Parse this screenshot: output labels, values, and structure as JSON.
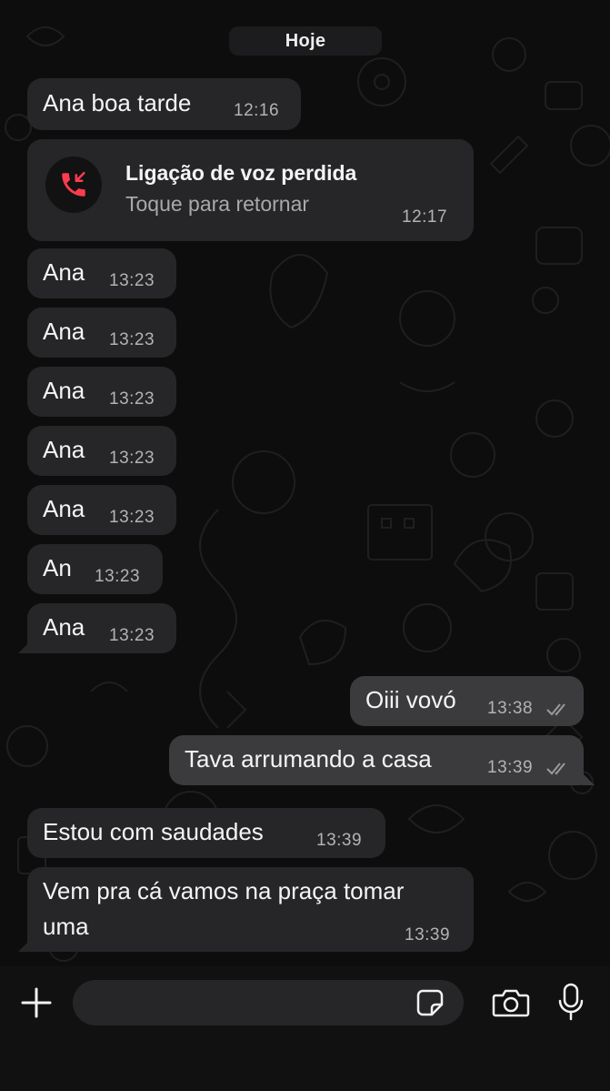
{
  "date_label": "Hoje",
  "messages": [
    {
      "text": "Ana boa tarde",
      "time": "12:16"
    },
    {
      "title": "Ligação de voz perdida",
      "subtitle": "Toque para retornar",
      "time": "12:17"
    },
    {
      "text": "Ana",
      "time": "13:23"
    },
    {
      "text": "Ana",
      "time": "13:23"
    },
    {
      "text": "Ana",
      "time": "13:23"
    },
    {
      "text": "Ana",
      "time": "13:23"
    },
    {
      "text": "Ana",
      "time": "13:23"
    },
    {
      "text": "An",
      "time": "13:23"
    },
    {
      "text": "Ana",
      "time": "13:23"
    },
    {
      "text": "Oiii vovó",
      "time": "13:38"
    },
    {
      "text": "Tava arrumando a casa",
      "time": "13:39"
    },
    {
      "text": "Estou com saudades",
      "time": "13:39"
    },
    {
      "line1": "Vem pra cá vamos na praça tomar",
      "line2": "uma",
      "time": "13:39"
    }
  ],
  "composer": {
    "placeholder": ""
  },
  "icons": {
    "attach": "plus-icon",
    "sticker": "sticker-icon",
    "camera": "camera-icon",
    "mic": "microphone-icon",
    "missed_call": "missed-call-icon",
    "read_receipt": "double-check-icon"
  },
  "colors": {
    "background": "#0d0d0d",
    "incoming_bubble": "#262628",
    "outgoing_bubble": "#3b3b3d",
    "missed_call_red": "#ff3b50"
  }
}
